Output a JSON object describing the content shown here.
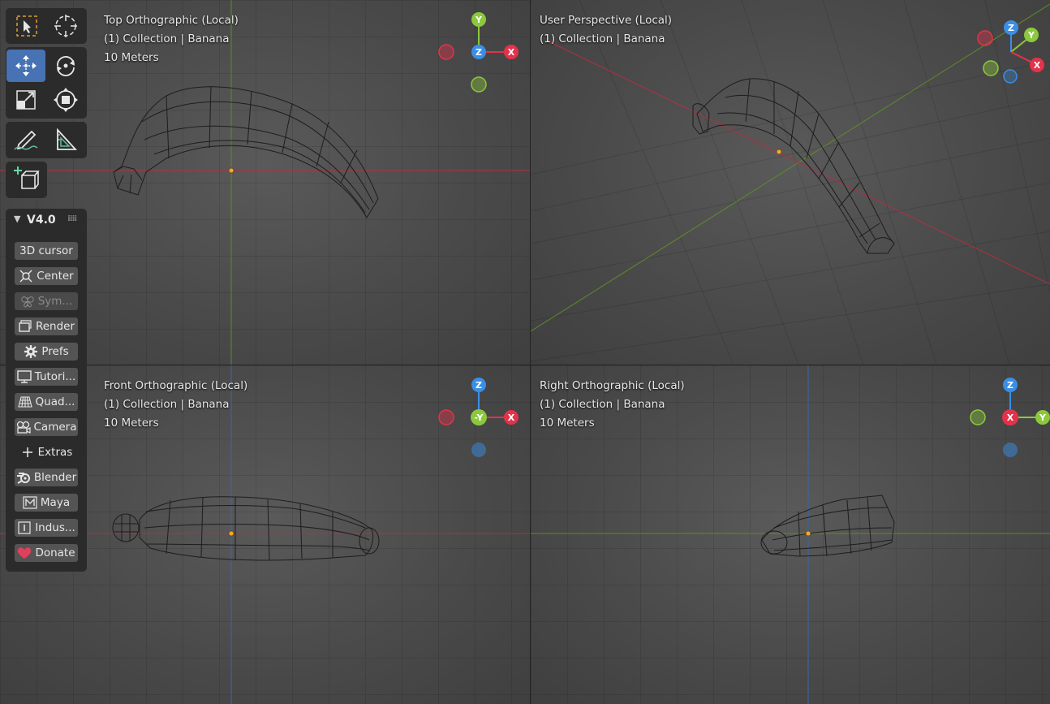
{
  "viewports": {
    "top": {
      "view": "Top Orthographic (Local)",
      "collection": "(1) Collection | Banana",
      "scale": "10 Meters"
    },
    "persp": {
      "view": "User Perspective (Local)",
      "collection": "(1) Collection | Banana"
    },
    "front": {
      "view": "Front Orthographic (Local)",
      "collection": "(1) Collection | Banana",
      "scale": "10 Meters"
    },
    "right": {
      "view": "Right Orthographic (Local)",
      "collection": "(1) Collection | Banana",
      "scale": "10 Meters"
    }
  },
  "gizmos": {
    "top": {
      "up": "Y",
      "center": "Z",
      "right": "X"
    },
    "persp": {
      "z": "Z",
      "y": "Y",
      "x": "X"
    },
    "front": {
      "up": "Z",
      "center": "-Y",
      "right": "X"
    },
    "right": {
      "up": "Z",
      "center": "X",
      "right": "Y"
    }
  },
  "colors": {
    "x_axis": "#e4324a",
    "y_axis": "#8cc83c",
    "z_axis": "#3a8ee6",
    "active_tool": "#4772b3",
    "origin": "#f5a623"
  },
  "toolbar": {
    "tools": [
      "select-box",
      "cursor",
      "move",
      "rotate",
      "scale",
      "transform",
      "annotate",
      "measure",
      "add-cube"
    ],
    "active": "move"
  },
  "panel": {
    "version": "V4.0",
    "buttons": {
      "cursor": "3D cursor",
      "center": "Center",
      "sym": "Sym...",
      "render": "Render",
      "prefs": "Prefs",
      "tutorials": "Tutori...",
      "quad": "Quad...",
      "camera": "Camera",
      "extras": "Extras",
      "blender": "Blender",
      "maya": "Maya",
      "industry": "Indus...",
      "donate": "Donate"
    }
  }
}
